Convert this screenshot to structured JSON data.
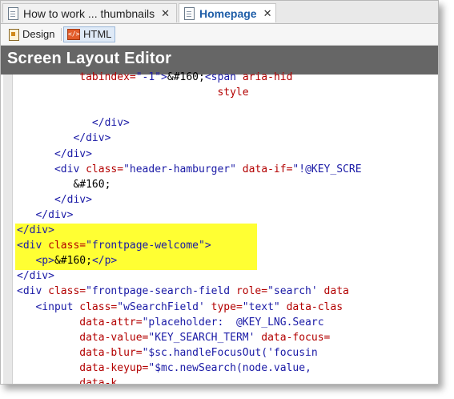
{
  "tabs": [
    {
      "label": "How to work ... thumbnails",
      "close": "✕",
      "active": false
    },
    {
      "label": "Homepage",
      "close": "✕",
      "active": true
    }
  ],
  "mode_bar": {
    "design_label": "Design",
    "html_label": "HTML"
  },
  "editor_title": "Screen Layout Editor",
  "code_lines": [
    {
      "indent": "          ",
      "segments": [
        {
          "t": "attr",
          "s": "tabindex="
        },
        {
          "t": "val",
          "s": "\"-1\""
        },
        {
          "t": "tag",
          "s": ">"
        },
        {
          "t": "txt",
          "s": "&#160;"
        },
        {
          "t": "tag",
          "s": "<span "
        },
        {
          "t": "attr",
          "s": "aria-hid"
        }
      ]
    },
    {
      "indent": "                                ",
      "segments": [
        {
          "t": "attr",
          "s": "style"
        }
      ]
    },
    {
      "indent": "",
      "segments": []
    },
    {
      "indent": "            ",
      "segments": [
        {
          "t": "tag",
          "s": "</div>"
        }
      ]
    },
    {
      "indent": "         ",
      "segments": [
        {
          "t": "tag",
          "s": "</div>"
        }
      ]
    },
    {
      "indent": "      ",
      "segments": [
        {
          "t": "tag",
          "s": "</div>"
        }
      ]
    },
    {
      "indent": "      ",
      "segments": [
        {
          "t": "tag",
          "s": "<div "
        },
        {
          "t": "attr",
          "s": "class="
        },
        {
          "t": "val",
          "s": "\"header-hamburger\" "
        },
        {
          "t": "attr",
          "s": "data-if="
        },
        {
          "t": "val",
          "s": "\"!@KEY_SCRE"
        }
      ]
    },
    {
      "indent": "         ",
      "segments": [
        {
          "t": "txt",
          "s": "&#160;"
        }
      ]
    },
    {
      "indent": "      ",
      "segments": [
        {
          "t": "tag",
          "s": "</div>"
        }
      ]
    },
    {
      "indent": "   ",
      "segments": [
        {
          "t": "tag",
          "s": "</div>"
        }
      ]
    },
    {
      "indent": "",
      "segments": [
        {
          "t": "tag",
          "s": "</div>"
        }
      ]
    },
    {
      "indent": "",
      "segments": [
        {
          "t": "tag",
          "s": "<div "
        },
        {
          "t": "attr",
          "s": "class="
        },
        {
          "t": "val",
          "s": "\"frontpage-welcome\""
        },
        {
          "t": "tag",
          "s": ">"
        }
      ]
    },
    {
      "indent": "   ",
      "segments": [
        {
          "t": "tag",
          "s": "<p>"
        },
        {
          "t": "txt",
          "s": "&#160;"
        },
        {
          "t": "tag",
          "s": "</p>"
        }
      ]
    },
    {
      "indent": "",
      "segments": [
        {
          "t": "tag",
          "s": "</div>"
        }
      ]
    },
    {
      "indent": "",
      "segments": [
        {
          "t": "tag",
          "s": "<div "
        },
        {
          "t": "attr",
          "s": "class="
        },
        {
          "t": "val",
          "s": "\"frontpage-search-field "
        },
        {
          "t": "attr",
          "s": "role="
        },
        {
          "t": "val",
          "s": "\"search' "
        },
        {
          "t": "attr",
          "s": "data"
        }
      ]
    },
    {
      "indent": "   ",
      "segments": [
        {
          "t": "tag",
          "s": "<input "
        },
        {
          "t": "attr",
          "s": "class="
        },
        {
          "t": "val",
          "s": "\"wSearchField' "
        },
        {
          "t": "attr",
          "s": "type="
        },
        {
          "t": "val",
          "s": "\"text\" "
        },
        {
          "t": "attr",
          "s": "data-clas"
        }
      ]
    },
    {
      "indent": "          ",
      "segments": [
        {
          "t": "attr",
          "s": "data-attr="
        },
        {
          "t": "val",
          "s": "\"placeholder:  @KEY_LNG.Searc"
        }
      ]
    },
    {
      "indent": "          ",
      "segments": [
        {
          "t": "attr",
          "s": "data-value="
        },
        {
          "t": "val",
          "s": "\"KEY_SEARCH_TERM' "
        },
        {
          "t": "attr",
          "s": "data-focus="
        }
      ]
    },
    {
      "indent": "          ",
      "segments": [
        {
          "t": "attr",
          "s": "data-blur="
        },
        {
          "t": "val",
          "s": "\"$sc.handleFocusOut('focusin"
        }
      ]
    },
    {
      "indent": "          ",
      "segments": [
        {
          "t": "attr",
          "s": "data-keyup="
        },
        {
          "t": "val",
          "s": "\"$mc.newSearch(node.value,"
        }
      ]
    },
    {
      "indent": "          ",
      "segments": [
        {
          "t": "attr",
          "s": "data-k..."
        }
      ]
    }
  ],
  "colors": {
    "tag": "#1a1aa6",
    "attr": "#b30000",
    "highlight": "#ffff33",
    "title_bar": "#666666"
  },
  "icons": {
    "tab_doc": "document-icon",
    "design_mode": "design-icon",
    "html_mode": "html-icon"
  }
}
